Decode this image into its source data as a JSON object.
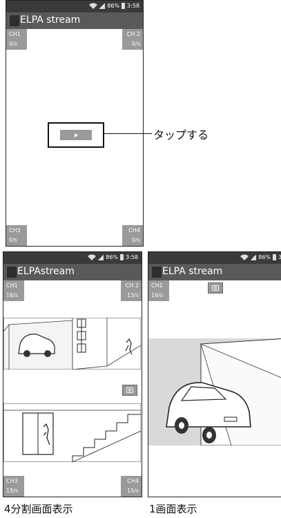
{
  "status": {
    "battery": "86%",
    "time": "3:58"
  },
  "app_title": "ELPA stream",
  "app_title_small": "ELPAstream",
  "top_screen": {
    "ch1": {
      "name": "CH1",
      "rate": "0/s"
    },
    "ch2": {
      "name": "CH 2",
      "rate": "0/s"
    },
    "ch3": {
      "name": "CH3",
      "rate": "0/s"
    },
    "ch4": {
      "name": "CH4",
      "rate": "0/s"
    },
    "callout": "タップする"
  },
  "quad_screen": {
    "ch1": {
      "name": "CH1",
      "rate": "16/s"
    },
    "ch2": {
      "name": "CH 2",
      "rate": "13/s"
    },
    "ch3": {
      "name": "CH3",
      "rate": "15/s"
    },
    "ch4": {
      "name": "CH4",
      "rate": "15/s"
    },
    "caption": "4分割画面表示"
  },
  "single_screen": {
    "ch1": {
      "name": "CH1",
      "rate": "16/s"
    },
    "caption": "1画面表示"
  },
  "icons": [
    "wifi-icon",
    "signal-icon",
    "battery-icon",
    "play-icon",
    "camera-icon",
    "app-icon"
  ],
  "colors": {
    "statusbar": "#3a3a3a",
    "titlebar": "#595959",
    "label_bg": "#9a9a9a",
    "floor": "#d9d9d9"
  }
}
